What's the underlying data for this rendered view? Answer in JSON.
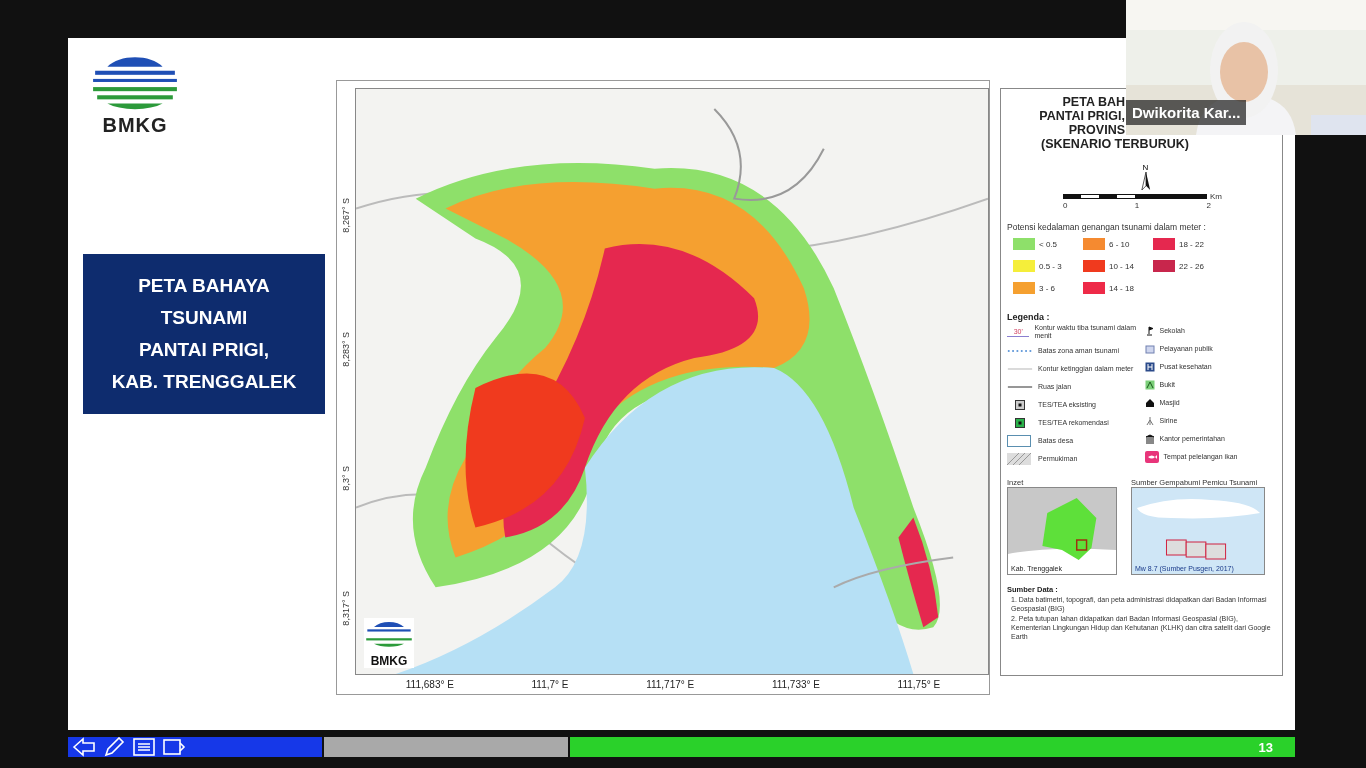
{
  "slide": {
    "logo_text": "BMKG",
    "title_lines": [
      "PETA BAHAYA",
      "TSUNAMI",
      "PANTAI PRIGI,",
      "KAB. TRENGGALEK"
    ],
    "map": {
      "kind": "picture",
      "logo_text": "BMKG",
      "lat_labels": [
        "8,267° S",
        "8,283° S",
        "8,3° S",
        "8,317° S"
      ],
      "lon_labels": [
        "111,683° E",
        "111,7° E",
        "111,717° E",
        "111,733° E",
        "111,75° E"
      ]
    },
    "legend": {
      "title_lines": [
        "PETA BAH",
        "PANTAI PRIGI,",
        "PROVINS",
        "(SKENARIO TERBURUK)"
      ],
      "north": "N",
      "scale_unit": "Km",
      "scale_ticks": [
        "0",
        "1",
        "2"
      ],
      "depth_title": "Potensi kedalaman genangan tsunami dalam meter :",
      "depth_classes": [
        {
          "label": "< 0.5",
          "color": "#8ee06a"
        },
        {
          "label": "0.5 - 3",
          "color": "#f5ee3a"
        },
        {
          "label": "3 - 6",
          "color": "#f5a030"
        },
        {
          "label": "6 - 10",
          "color": "#f58a30"
        },
        {
          "label": "10 - 14",
          "color": "#f03a1e"
        },
        {
          "label": "14 - 18",
          "color": "#ee2a48"
        },
        {
          "label": "18 - 22",
          "color": "#e5284f"
        },
        {
          "label": "22 - 26",
          "color": "#c8264c"
        }
      ],
      "legend_title": "Legenda :",
      "symbols_left": [
        {
          "kind": "time-contour",
          "symbol_text": "30'",
          "label": "Kontur waktu tiba tsunami dalam menit"
        },
        {
          "kind": "dotted",
          "label": "Batas zona aman tsunami"
        },
        {
          "kind": "thin-line",
          "label": "Kontur ketinggian dalam meter"
        },
        {
          "kind": "road",
          "label": "Ruas jalan"
        },
        {
          "kind": "tes-existing",
          "label": "TES/TEA eksisting"
        },
        {
          "kind": "tes-recommended",
          "label": "TES/TEA rekomendasi"
        },
        {
          "kind": "boundary",
          "label": "Batas desa"
        },
        {
          "kind": "hatch",
          "label": "Permukiman"
        }
      ],
      "symbols_right": [
        {
          "kind": "flag",
          "label": "Sekolah"
        },
        {
          "kind": "building",
          "label": "Pelayanan publik"
        },
        {
          "kind": "health",
          "label": "Pusat kesehatan"
        },
        {
          "kind": "hill",
          "label": "Bukit"
        },
        {
          "kind": "mosque",
          "label": "Masjid"
        },
        {
          "kind": "siren",
          "label": "Sirine"
        },
        {
          "kind": "office",
          "label": "Kantor pemerintahan"
        },
        {
          "kind": "fish",
          "label": "Tempat pelelangan ikan"
        }
      ],
      "inset_title": "Inzet",
      "inset_caption": "Kab. Trenggalek",
      "source_title": "Sumber Gempabumi Pemicu Tsunami",
      "source_caption": "Mw 8.7 (Sumber Pusgen, 2017)",
      "data_title": "Sumber Data :",
      "data_notes": [
        "1. Data batimetri, topografi, dan peta administrasi didapatkan dari Badan Informasi Geospasial (BIG)",
        "2. Peta tutupan lahan didapatkan dari Badan Informasi Geospasial (BIG), Kementerian Lingkungan Hidup dan Kehutanan (KLHK) dan citra satelit dari Google Earth"
      ]
    },
    "page_number": "13"
  },
  "video": {
    "kind": "picture",
    "name": "Dwikorita Kar..."
  }
}
